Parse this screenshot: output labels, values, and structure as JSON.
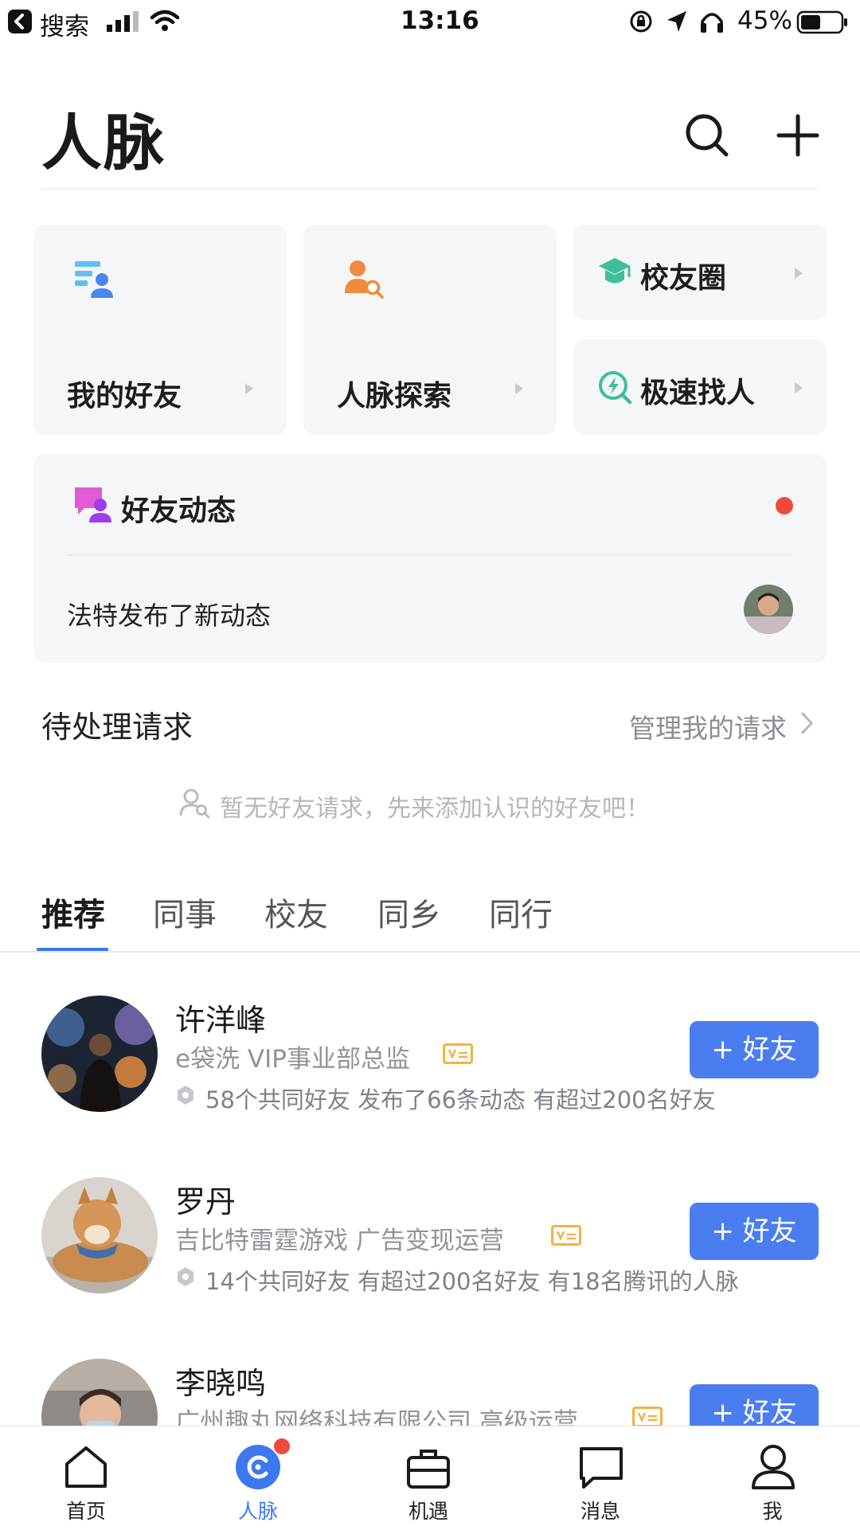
{
  "status_bar": {
    "back_label": "搜索",
    "time": "13:16",
    "battery": "45%"
  },
  "header": {
    "title": "人脉"
  },
  "quick_cards": {
    "my_friends": "我的好友",
    "network_explore": "人脉探索",
    "alumni": "校友圈",
    "quick_find": "极速找人"
  },
  "friend_feed": {
    "title": "好友动态",
    "latest": "法特发布了新动态"
  },
  "pending": {
    "title": "待处理请求",
    "manage_link": "管理我的请求",
    "empty_text": "暂无好友请求，先来添加认识的好友吧！"
  },
  "tabs": [
    {
      "label": "推荐",
      "active": true
    },
    {
      "label": "同事",
      "active": false
    },
    {
      "label": "校友",
      "active": false
    },
    {
      "label": "同乡",
      "active": false
    },
    {
      "label": "同行",
      "active": false
    }
  ],
  "recommendations": [
    {
      "name": "许洋峰",
      "company": "e袋洗  VIP事业部总监",
      "stats": "58个共同好友   发布了66条动态   有超过200名好友",
      "button": "+ 好友"
    },
    {
      "name": "罗丹",
      "company": "吉比特雷霆游戏  广告变现运营",
      "stats": "14个共同好友   有超过200名好友   有18名腾讯的人脉",
      "button": "+ 好友"
    },
    {
      "name": "李晓鸣",
      "company": "广州趣丸网络科技有限公司  高级运营",
      "stats": "",
      "button": "+ 好友"
    }
  ],
  "bottom_nav": [
    {
      "label": "首页"
    },
    {
      "label": "人脉"
    },
    {
      "label": "机遇"
    },
    {
      "label": "消息"
    },
    {
      "label": "我"
    }
  ],
  "colors": {
    "accent": "#4a7ef0",
    "nav_active": "#3e78f0",
    "badge_red": "#f04a3e",
    "verified": "#f0b443"
  }
}
